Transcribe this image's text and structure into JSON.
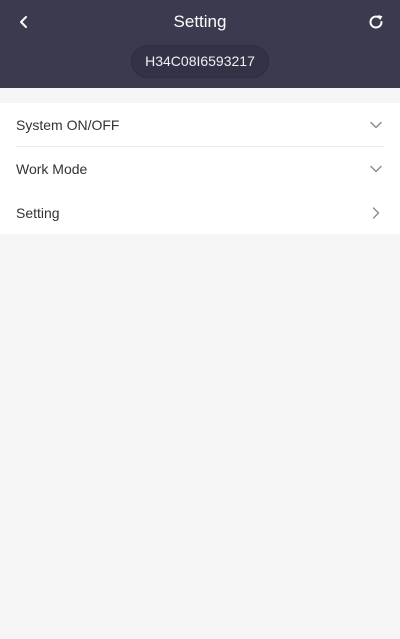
{
  "header": {
    "title": "Setting",
    "device_id": "H34C08I6593217",
    "back_icon": "chevron-left-icon",
    "refresh_icon": "refresh-icon",
    "background_color": "#3c3a4f"
  },
  "menu": {
    "items": [
      {
        "label": "System ON/OFF",
        "icon": "chevron-down-icon"
      },
      {
        "label": "Work Mode",
        "icon": "chevron-down-icon"
      },
      {
        "label": "Setting",
        "icon": "chevron-right-icon"
      }
    ]
  }
}
